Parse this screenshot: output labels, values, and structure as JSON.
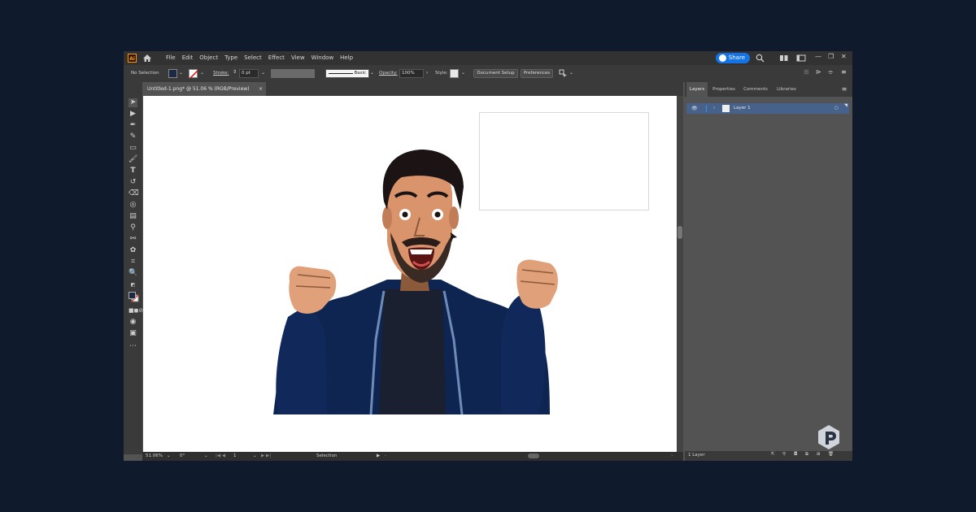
{
  "app": {
    "logo": "Ai"
  },
  "menus": [
    "File",
    "Edit",
    "Object",
    "Type",
    "Select",
    "Effect",
    "View",
    "Window",
    "Help"
  ],
  "share": {
    "label": "Share"
  },
  "control_bar": {
    "selection": "No Selection",
    "stroke_label": "Stroke:",
    "stroke_value": "0 pt",
    "profile_label": "Basic",
    "opacity_label": "Opacity:",
    "opacity_value": "100%",
    "style_label": "Style:",
    "document_setup": "Document Setup",
    "preferences": "Preferences"
  },
  "document_tab": {
    "title": "Untitled-1.png* @ 51.06 % (RGB/Preview)",
    "close": "×"
  },
  "status_bar": {
    "zoom": "51.06%",
    "rotation": "0°",
    "artboard": "1",
    "tool": "Selection"
  },
  "panel": {
    "tabs": [
      "Layers",
      "Properties",
      "Comments",
      "Libraries"
    ],
    "active_tab": "Layers",
    "layers": [
      {
        "name": "Layer 1"
      }
    ],
    "footer_count": "1 Layer"
  },
  "colors": {
    "accent": "#1473e6",
    "layer_selected": "#46628a",
    "background": "#101a2d",
    "jacket": "#0d2550"
  }
}
